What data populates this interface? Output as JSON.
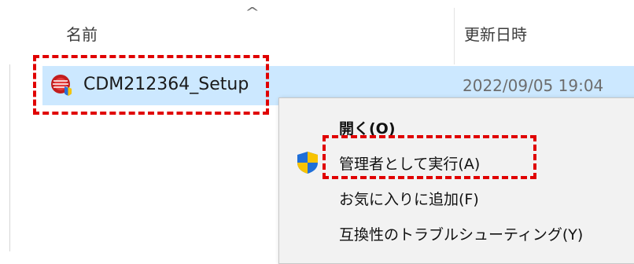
{
  "columns": {
    "name_label": "名前",
    "date_label": "更新日時"
  },
  "file": {
    "name": "CDM212364_Setup",
    "modified": "2022/09/05 19:04",
    "icon": "setup-installer-icon"
  },
  "context_menu": {
    "items": [
      {
        "label": "開く(O)",
        "bold": true
      },
      {
        "label": "管理者として実行(A)",
        "icon": "uac-shield-icon"
      },
      {
        "label": "お気に入りに追加(F)"
      },
      {
        "label": "互換性のトラブルシューティング(Y)"
      }
    ]
  },
  "colors": {
    "selection": "#cce8ff",
    "highlight": "#e00000",
    "menu_bg": "#f2f2f2"
  }
}
